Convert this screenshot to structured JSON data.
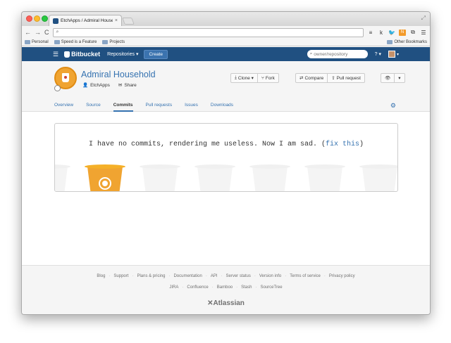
{
  "browser": {
    "tab_title": "EtchApps / Admiral Househ",
    "tab_close": "×",
    "omnibox_value": "",
    "bookmarks": [
      "Personal",
      "Speed is a Feature",
      "Projects"
    ],
    "other_bookmarks": "Other Bookmarks",
    "extensions": [
      "≡",
      "k",
      "🐦",
      "N",
      "⧉",
      "☰"
    ]
  },
  "nav": {
    "brand": "Bitbucket",
    "repositories": "Repositories ▾",
    "create": "Create",
    "search_placeholder": "owner/repository",
    "help": "? ▾"
  },
  "repo": {
    "title": "Admiral Household",
    "owner": "EtchApps",
    "share": "Share",
    "clone": "Clone ▾",
    "fork": "Fork",
    "compare": "Compare",
    "pull_request": "Pull request",
    "watch": "👁",
    "more": "▾"
  },
  "tabs": [
    "Overview",
    "Source",
    "Commits",
    "Pull requests",
    "Issues",
    "Downloads"
  ],
  "active_tab": "Commits",
  "empty_state": {
    "message": "I have no commits, rendering me useless. Now I am sad. (",
    "link": "fix this",
    "close": ")"
  },
  "footer": {
    "row1": [
      "Blog",
      "Support",
      "Plans & pricing",
      "Documentation",
      "API",
      "Server status",
      "Version info",
      "Terms of service",
      "Privacy policy"
    ],
    "row2": [
      "JIRA",
      "Confluence",
      "Bamboo",
      "Stash",
      "SourceTree"
    ],
    "brand": "Atlassian"
  },
  "colors": {
    "brand_blue": "#205081",
    "link_blue": "#3572b0",
    "bucket_orange": "#f0a431"
  }
}
